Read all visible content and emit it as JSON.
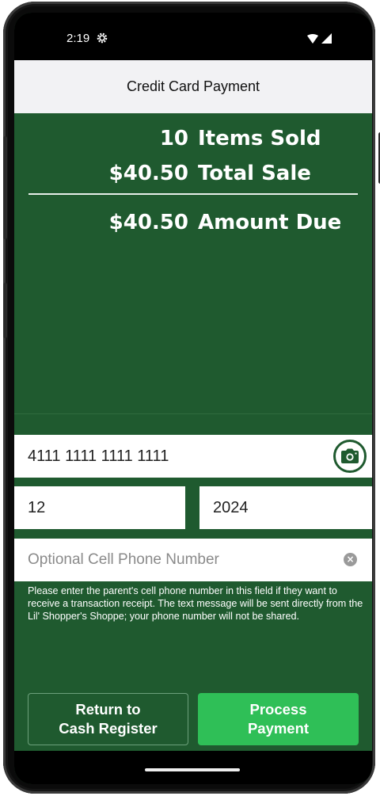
{
  "status_bar": {
    "time": "2:19",
    "icons": [
      "gear-icon",
      "wifi-icon",
      "signal-icon"
    ]
  },
  "header": {
    "title": "Credit Card Payment"
  },
  "summary": {
    "items_value": "10",
    "items_label": "Items Sold",
    "total_value": "$40.50",
    "total_label": "Total Sale",
    "due_value": "$40.50",
    "due_label": "Amount Due"
  },
  "form": {
    "card_number": "4111 1111 1111 1111",
    "exp_month": "12",
    "exp_year": "2024",
    "phone_placeholder": "Optional Cell Phone Number",
    "help_text": "Please enter the parent's cell phone number in this field if they want to receive a transaction receipt.  The text message will be sent directly from the Lil' Shopper's Shoppe; your phone number will not be shared."
  },
  "buttons": {
    "return_line1": "Return to",
    "return_line2": "Cash Register",
    "process_line1": "Process",
    "process_line2": "Payment"
  },
  "colors": {
    "background_green": "#1f5a2f",
    "process_button": "#2fbf57",
    "title_bar": "#f2f2f4"
  }
}
